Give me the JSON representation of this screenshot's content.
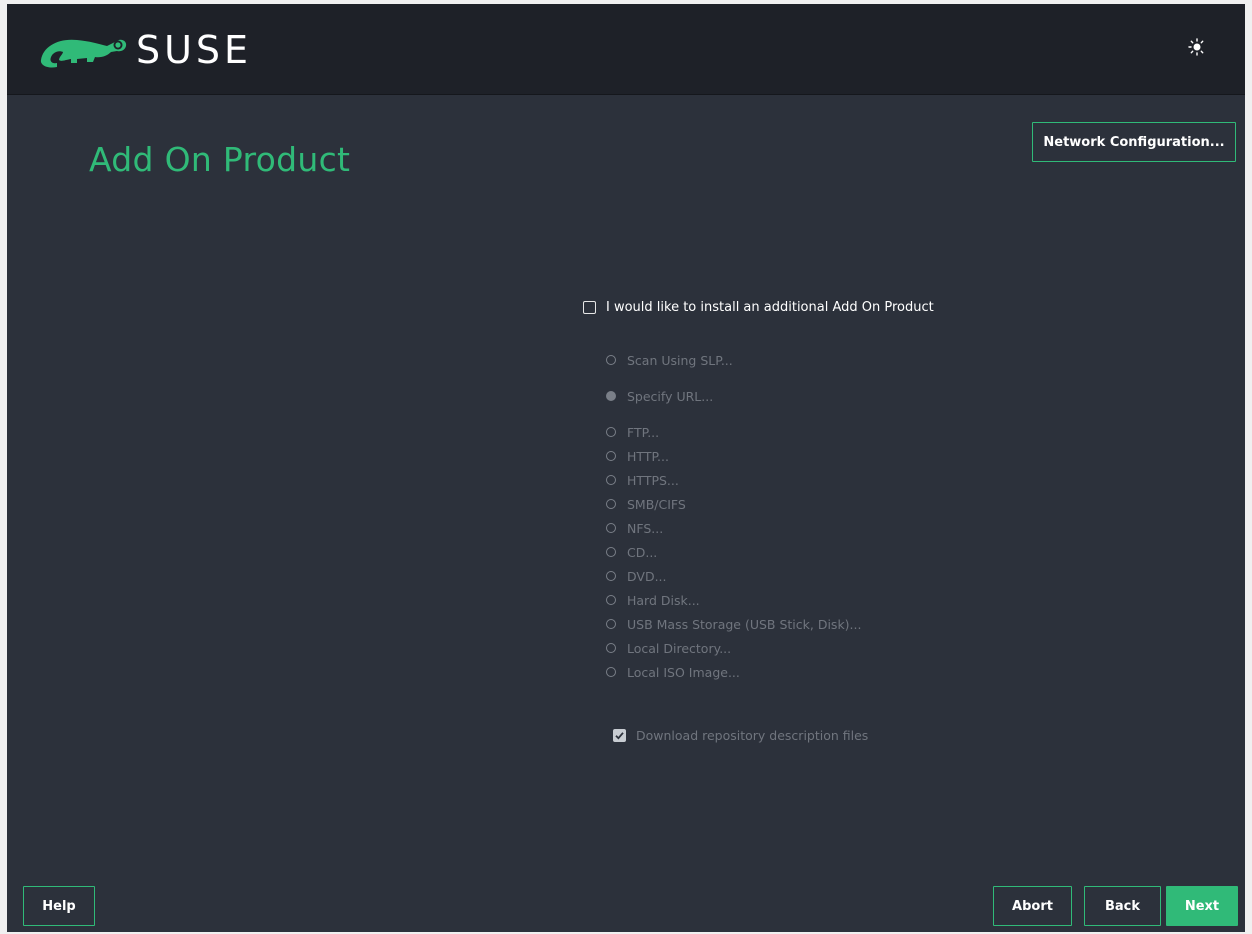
{
  "header": {
    "brand": "SUSE",
    "logo_icon": "chameleon-logo-icon",
    "theme_toggle_icon": "theme-toggle-icon",
    "accent_color": "#30ba78"
  },
  "page": {
    "title": "Add On Product"
  },
  "buttons": {
    "network_configuration": "Network Configuration...",
    "help": "Help",
    "abort": "Abort",
    "back": "Back",
    "next": "Next"
  },
  "form": {
    "install_addon_label": "I would like to install an additional Add On Product",
    "install_addon_checked": false,
    "source_options": [
      {
        "label": "Scan Using SLP...",
        "selected": false,
        "enabled": false
      },
      {
        "label": "Specify URL...",
        "selected": true,
        "enabled": false
      },
      {
        "label": "FTP...",
        "selected": false,
        "enabled": false
      },
      {
        "label": "HTTP...",
        "selected": false,
        "enabled": false
      },
      {
        "label": "HTTPS...",
        "selected": false,
        "enabled": false
      },
      {
        "label": "SMB/CIFS",
        "selected": false,
        "enabled": false
      },
      {
        "label": "NFS...",
        "selected": false,
        "enabled": false
      },
      {
        "label": "CD...",
        "selected": false,
        "enabled": false
      },
      {
        "label": "DVD...",
        "selected": false,
        "enabled": false
      },
      {
        "label": "Hard Disk...",
        "selected": false,
        "enabled": false
      },
      {
        "label": "USB Mass Storage (USB Stick, Disk)...",
        "selected": false,
        "enabled": false
      },
      {
        "label": "Local Directory...",
        "selected": false,
        "enabled": false
      },
      {
        "label": "Local ISO Image...",
        "selected": false,
        "enabled": false
      }
    ],
    "download_descriptions_label": "Download repository description files",
    "download_descriptions_checked": true
  }
}
